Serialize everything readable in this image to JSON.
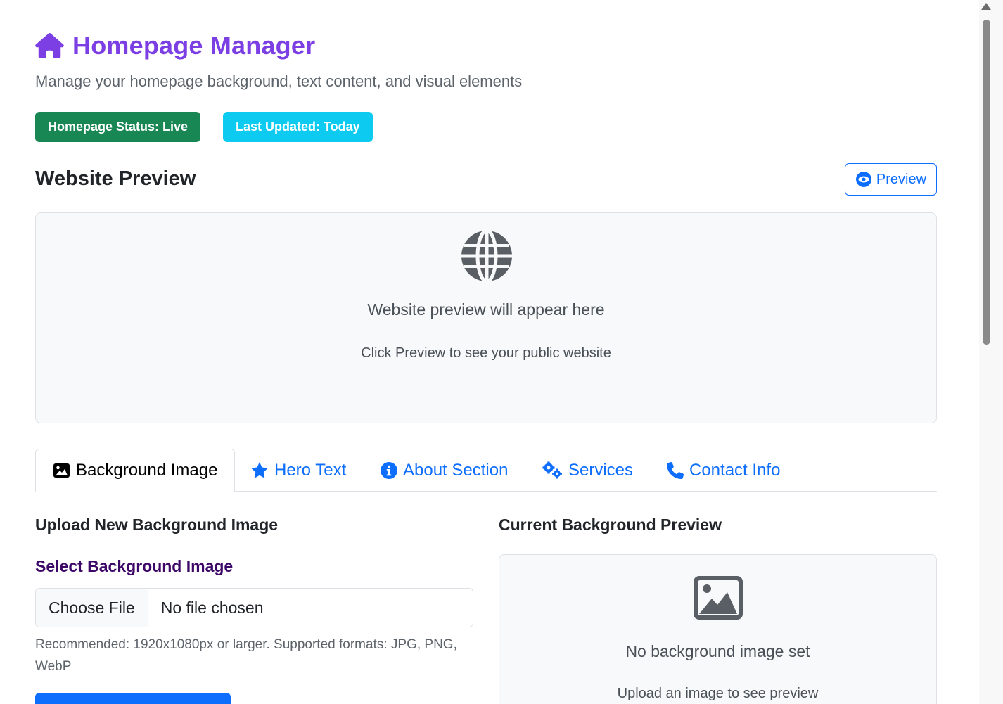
{
  "header": {
    "title": "Homepage Manager",
    "icon": "home-icon",
    "subtitle": "Manage your homepage background, text content, and visual elements"
  },
  "badges": {
    "status": "Homepage Status: Live",
    "updated": "Last Updated: Today"
  },
  "preview_section": {
    "title": "Website Preview",
    "button_label": "Preview",
    "placeholder_title": "Website preview will appear here",
    "placeholder_subtitle": "Click Preview to see your public website"
  },
  "tabs": [
    {
      "label": "Background Image",
      "icon": "image-icon",
      "active": true
    },
    {
      "label": "Hero Text",
      "icon": "star-icon",
      "active": false
    },
    {
      "label": "About Section",
      "icon": "info-icon",
      "active": false
    },
    {
      "label": "Services",
      "icon": "gears-icon",
      "active": false
    },
    {
      "label": "Contact Info",
      "icon": "phone-icon",
      "active": false
    }
  ],
  "upload": {
    "title": "Upload New Background Image",
    "field_label": "Select Background Image",
    "choose_button": "Choose File",
    "file_status": "No file chosen",
    "help_text": "Recommended: 1920x1080px or larger. Supported formats: JPG, PNG, WebP"
  },
  "current_preview": {
    "title": "Current Background Preview",
    "placeholder_title": "No background image set",
    "placeholder_subtitle": "Upload an image to see preview"
  },
  "colors": {
    "brand": "#7b3fe4",
    "primary": "#0d6efd",
    "success": "#198754",
    "info": "#0dcaf0"
  }
}
